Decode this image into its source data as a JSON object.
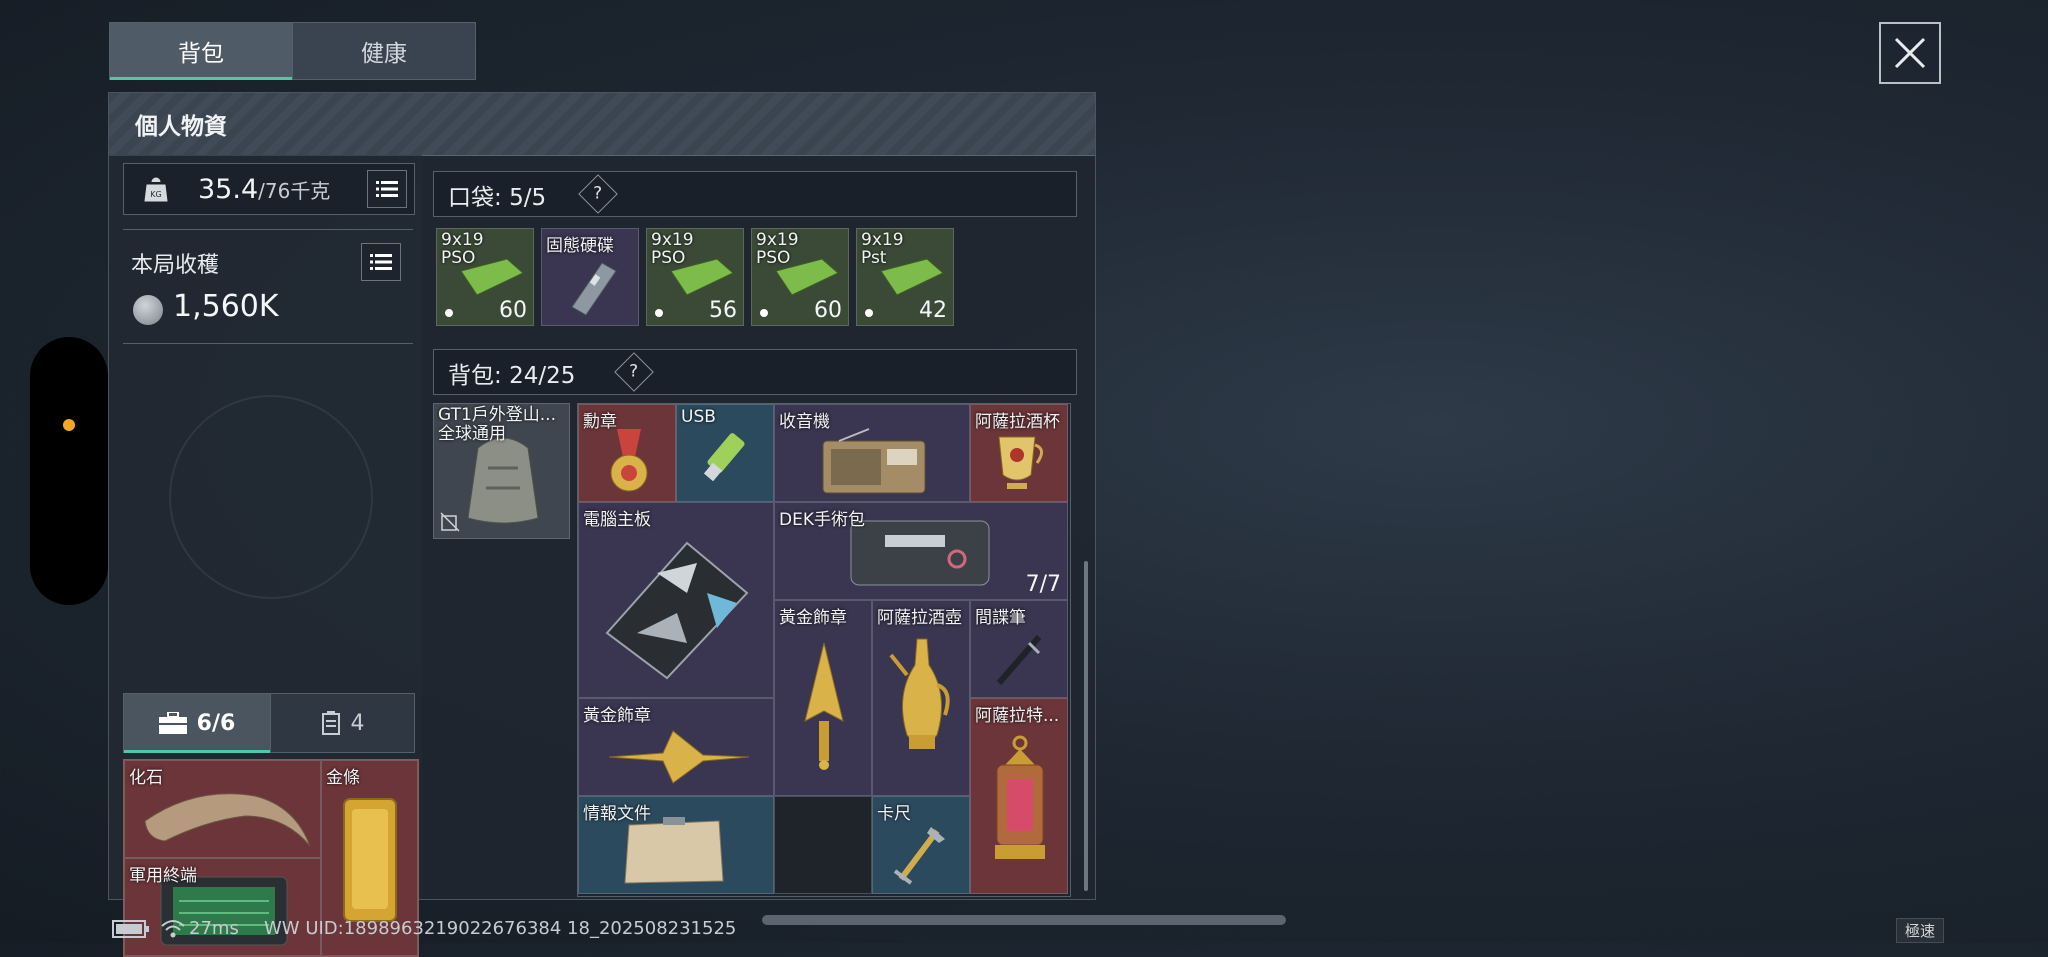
{
  "tabs": {
    "backpack": "背包",
    "health": "健康"
  },
  "panel": {
    "title": "個人物資"
  },
  "weight": {
    "current": "35.4",
    "max": "/76千克",
    "icon": "kg-weight-icon"
  },
  "haul": {
    "label": "本局收穫",
    "value": "1,560K"
  },
  "safe_tabs": {
    "case": "6/6",
    "other": "4"
  },
  "safe_items": [
    {
      "label": "化石"
    },
    {
      "label": "金條"
    },
    {
      "label": "軍用終端"
    }
  ],
  "pocket": {
    "label": "口袋:",
    "count": "5/5",
    "help": "?"
  },
  "pocket_items": [
    {
      "label": "9x19 PSO",
      "count": "60"
    },
    {
      "label": "固態硬碟",
      "count": ""
    },
    {
      "label": "9x19 PSO",
      "count": "56"
    },
    {
      "label": "9x19 PSO",
      "count": "60"
    },
    {
      "label": "9x19 Pst",
      "count": "42"
    }
  ],
  "backpack": {
    "label": "背包:",
    "count": "24/25",
    "help": "?",
    "equipped": "GT1戶外登山... 全球通用"
  },
  "backpack_items": [
    {
      "label": "勳章"
    },
    {
      "label": "USB"
    },
    {
      "label": "收音機"
    },
    {
      "label": "阿薩拉酒杯"
    },
    {
      "label": "電腦主板"
    },
    {
      "label": "DEK手術包",
      "count": "7/7"
    },
    {
      "label": "黃金飾章"
    },
    {
      "label": "阿薩拉酒壺"
    },
    {
      "label": "間諜筆"
    },
    {
      "label": "黃金飾章"
    },
    {
      "label": "阿薩拉特..."
    },
    {
      "label": "情報文件"
    },
    {
      "label": "卡尺"
    }
  ],
  "status": {
    "ping": "27ms",
    "uid": "WW UID:1898963219022676384 18_202508231525",
    "speed": "極速"
  },
  "colors": {
    "accent": "#4ec9a5",
    "red_slot": "#6b3539",
    "notice_dot": "#f5a623"
  }
}
